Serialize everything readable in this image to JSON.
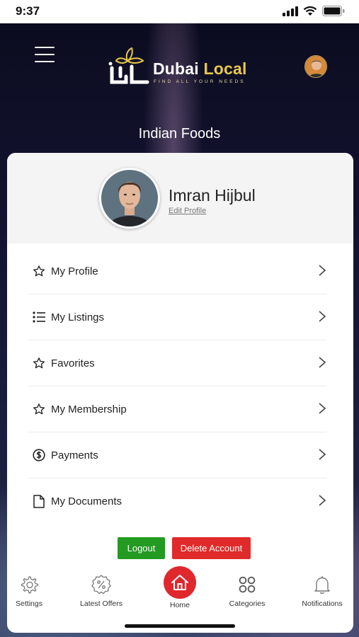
{
  "status_bar": {
    "time": "9:37"
  },
  "header": {
    "brand_part1": "Dubai",
    "brand_part2": "Local",
    "tagline": "FIND ALL YOUR NEEDS",
    "screen_title": "Indian Foods"
  },
  "profile": {
    "name": "Imran Hijbul",
    "edit_label": "Edit Profile"
  },
  "menu": [
    {
      "label": "My Profile",
      "icon": "star-icon"
    },
    {
      "label": "My Listings",
      "icon": "list-icon"
    },
    {
      "label": "Favorites",
      "icon": "star-icon"
    },
    {
      "label": "My Membership",
      "icon": "star-icon"
    },
    {
      "label": "Payments",
      "icon": "dollar-icon"
    },
    {
      "label": "My Documents",
      "icon": "document-icon"
    }
  ],
  "actions": {
    "logout": "Logout",
    "delete_account": "Delete Account"
  },
  "bottom_nav": [
    {
      "label": "Settings",
      "icon": "gear-icon"
    },
    {
      "label": "Latest Offers",
      "icon": "discount-icon"
    },
    {
      "label": "Home",
      "icon": "home-icon"
    },
    {
      "label": "Categories",
      "icon": "grid-icon"
    },
    {
      "label": "Notifications",
      "icon": "bell-icon"
    }
  ],
  "colors": {
    "accent": "#e0272c",
    "logout": "#239a22",
    "brand_gold": "#e9c84a"
  }
}
